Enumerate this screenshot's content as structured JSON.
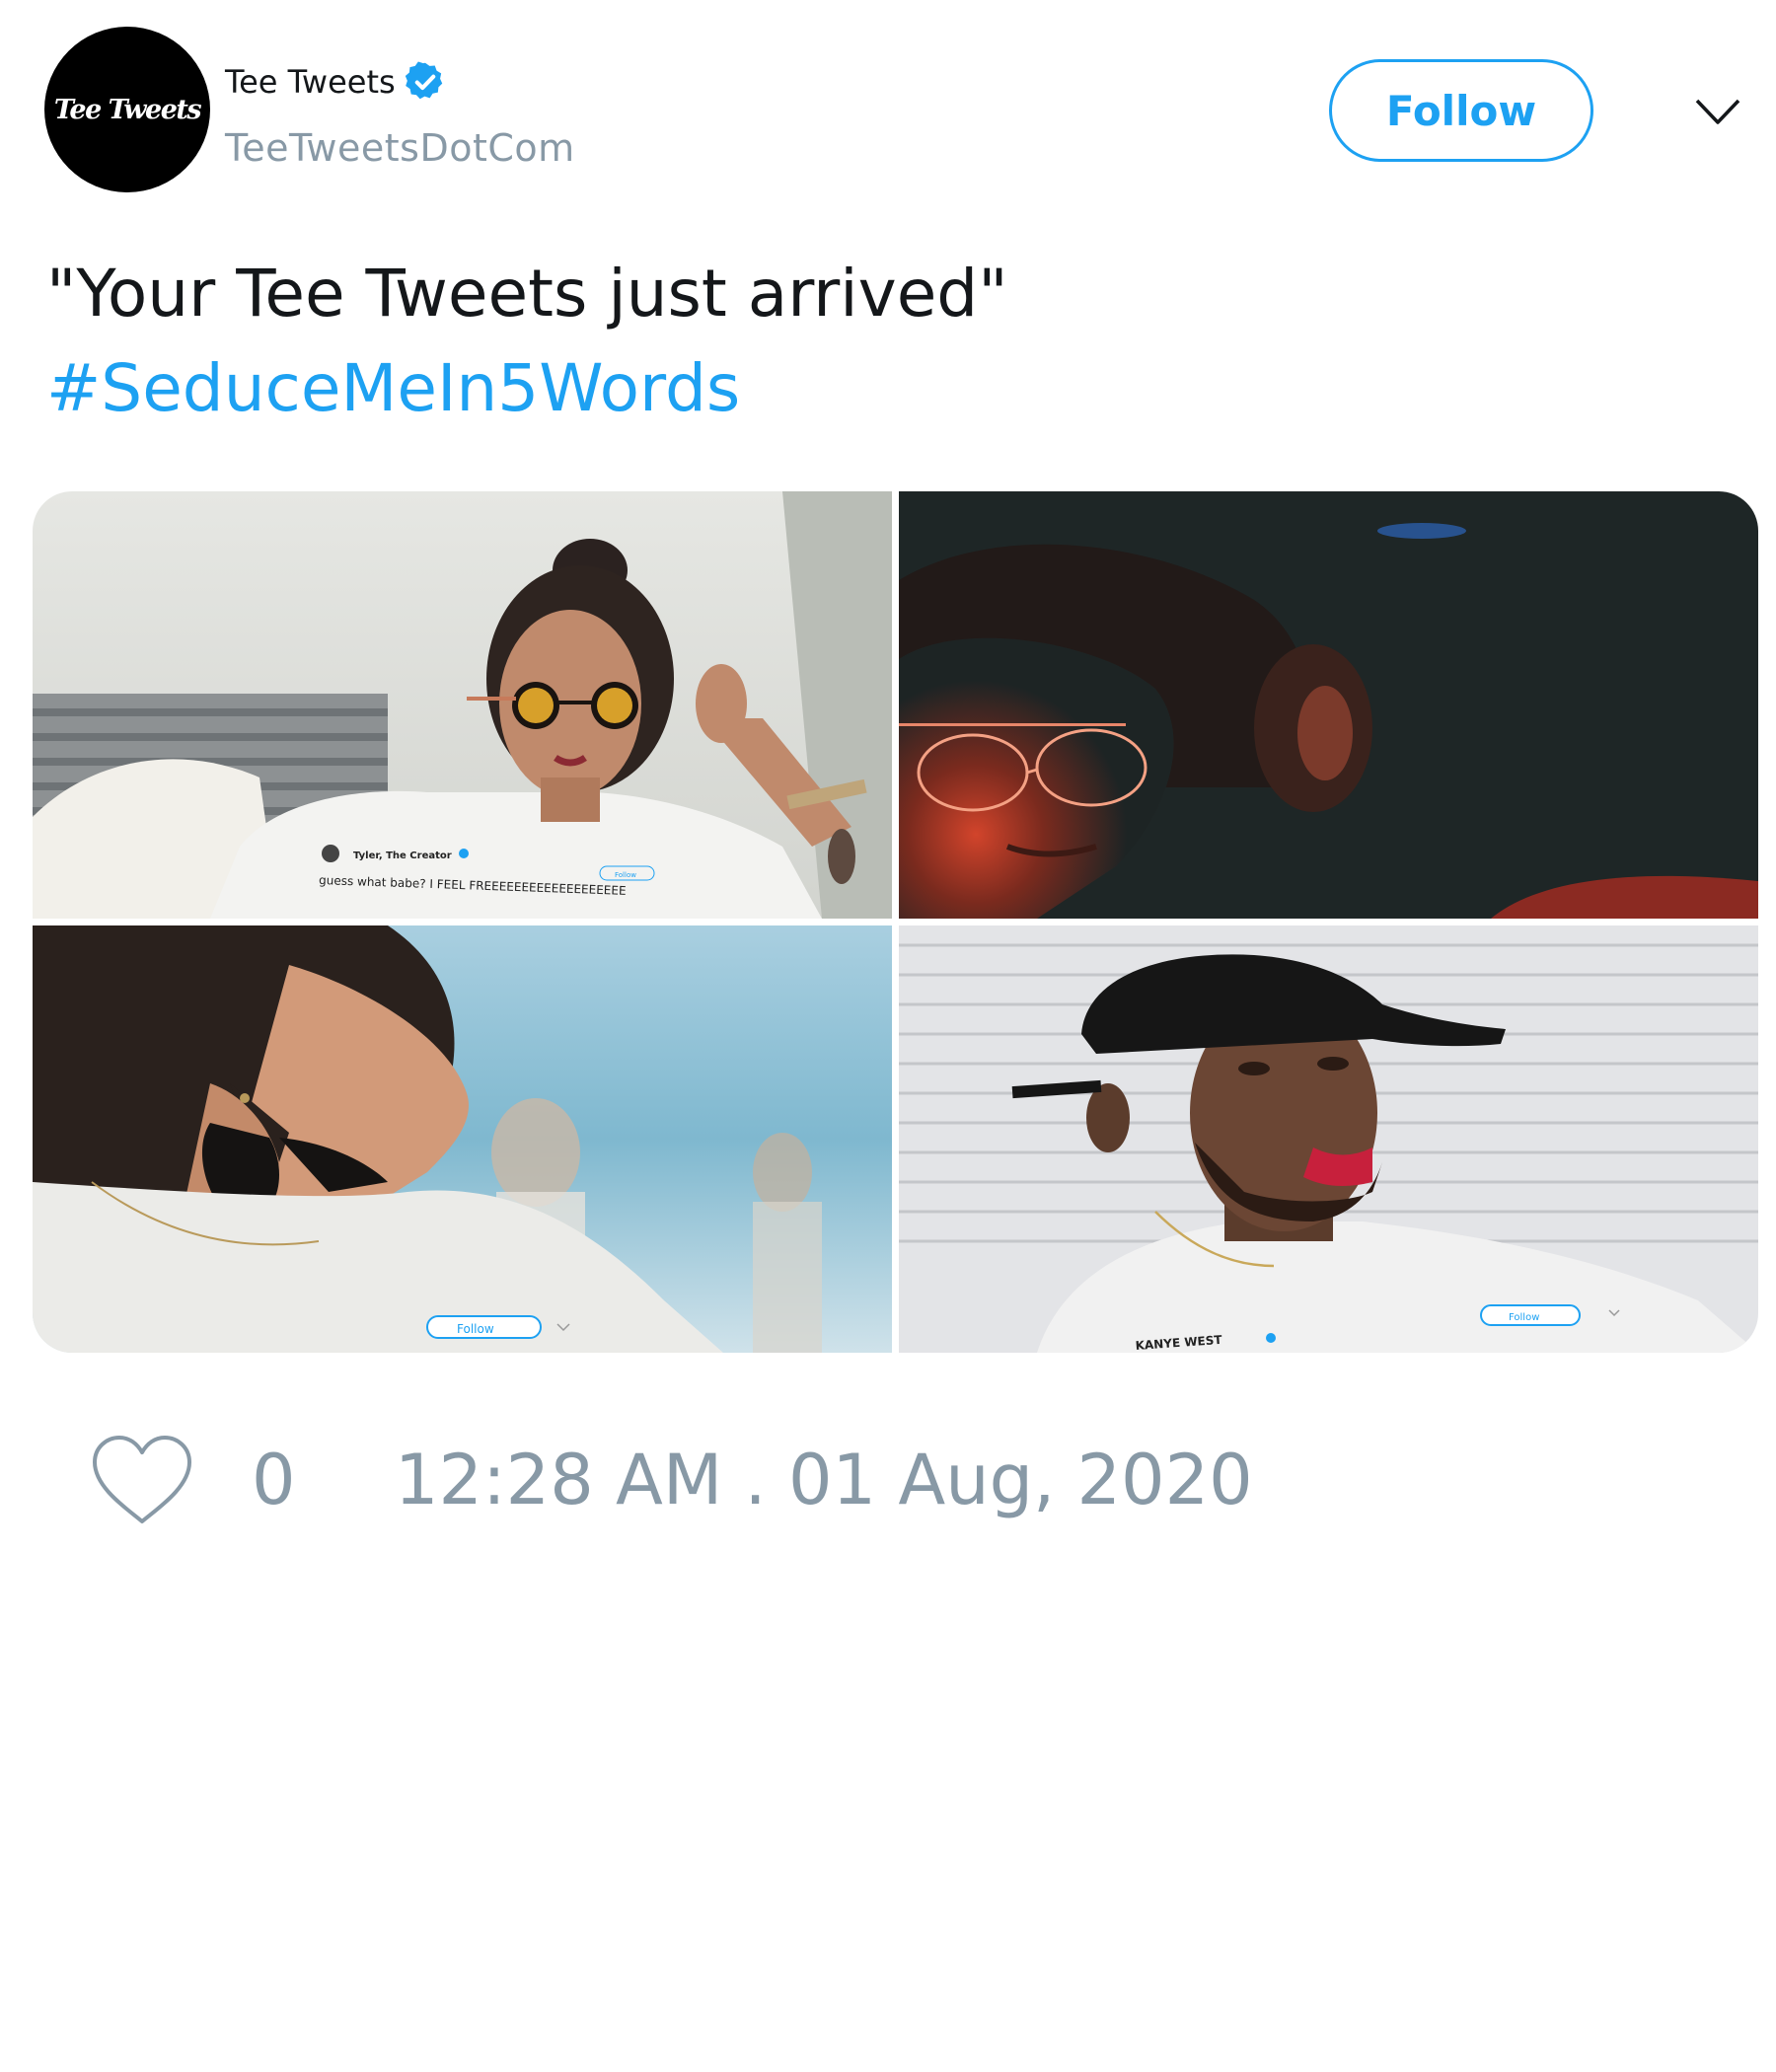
{
  "author": {
    "avatar_text": "Tee Tweets",
    "display_name": "Tee Tweets",
    "username": "TeeTweetsDotCom",
    "verified": true
  },
  "actions": {
    "follow_label": "Follow",
    "menu_icon": "chevron-down-icon"
  },
  "tweet": {
    "text": "\"Your Tee Tweets just arrived\"",
    "hashtag": "#SeduceMeIn5Words"
  },
  "media": {
    "tile1": {
      "shirt_name": "Tyler, The Creator",
      "shirt_text": "guess what babe? I FEEL FREEEEEEEEEEEEEEEEEEE",
      "shirt_button": "Follow"
    },
    "tile3": {
      "shirt_button": "Follow"
    },
    "tile4": {
      "shirt_button": "Follow",
      "shirt_name": "KANYE WEST"
    }
  },
  "footer": {
    "like_count": "0",
    "timestamp": "12:28 AM . 01 Aug, 2020",
    "heart_icon": "heart-icon"
  },
  "colors": {
    "accent": "#1da1f2",
    "secondary_text": "#8899a6",
    "primary_text": "#14171a"
  }
}
